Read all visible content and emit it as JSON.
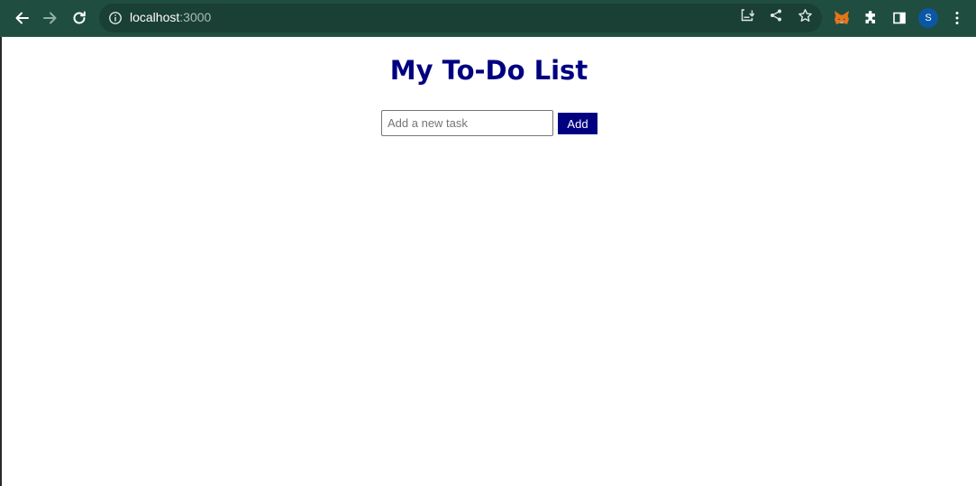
{
  "browser": {
    "url_host": "localhost",
    "url_port": ":3000",
    "profile_initial": "S",
    "icons": {
      "back": "back-arrow-icon",
      "forward": "forward-arrow-icon",
      "reload": "reload-icon",
      "site_info": "info-icon",
      "install": "install-app-icon",
      "share": "share-icon",
      "bookmark": "star-icon",
      "metamask": "fox-icon",
      "extensions": "puzzle-icon",
      "side_panel": "side-panel-icon",
      "menu": "kebab-menu-icon"
    },
    "colors": {
      "toolbar": "#1f4d40",
      "omnibox": "#1a3f35",
      "avatar": "#0b57a6"
    }
  },
  "app": {
    "title": "My To-Do List",
    "input_placeholder": "Add a new task",
    "input_value": "",
    "add_label": "Add",
    "colors": {
      "accent": "#000080"
    }
  }
}
